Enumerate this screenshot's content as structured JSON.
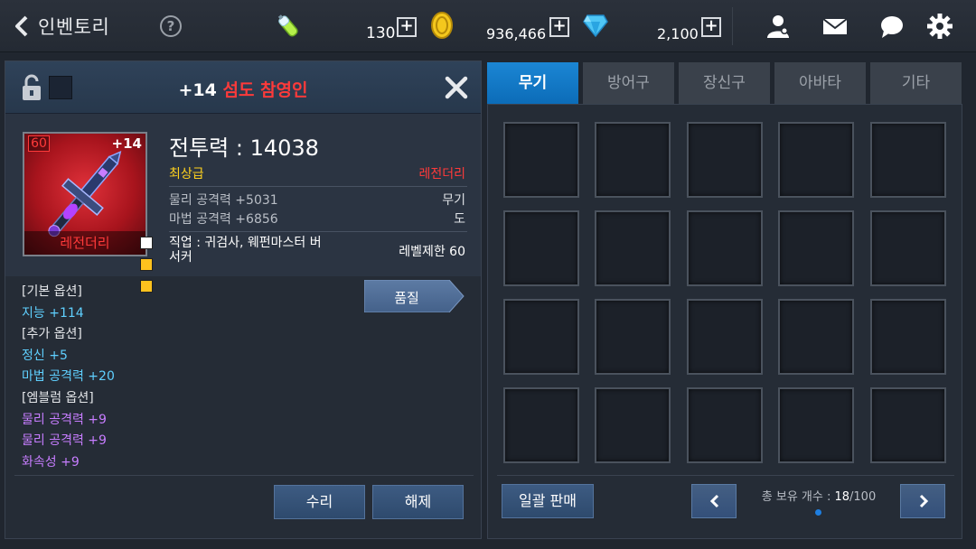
{
  "header": {
    "back_label": "인벤토리",
    "help": "?",
    "currencies": [
      {
        "icon": "potion-icon",
        "value": "130"
      },
      {
        "icon": "gold-coin-icon",
        "value": "936,466"
      },
      {
        "icon": "diamond-icon",
        "value": "2,100"
      }
    ],
    "plus": "+"
  },
  "item": {
    "enhance_prefix": "+14",
    "name": "섬도 참영인",
    "level": "60",
    "enhance": "+14",
    "rarity_label": "레전더리",
    "power_label": "전투력 : 14038",
    "grade": "최상급",
    "rarity": "레전더리",
    "phys_attack": "물리 공격력 +5031",
    "magic_attack": "마법 공격력 +6856",
    "type": "무기",
    "subtype": "도",
    "job": "직업 : 귀검사, 웨펀마스터 버서커",
    "level_req": "레벨제한 60",
    "quality_btn": "품질",
    "options": [
      {
        "text": "[기본 옵션]",
        "kind": "header"
      },
      {
        "text": "지능 +114",
        "kind": "basic"
      },
      {
        "text": "[추가 옵션]",
        "kind": "header"
      },
      {
        "text": "정신 +5",
        "kind": "basic"
      },
      {
        "text": "마법 공격력 +20",
        "kind": "basic"
      },
      {
        "text": "[엠블럼 옵션]",
        "kind": "header"
      },
      {
        "text": "물리 공격력 +9",
        "kind": "emblem"
      },
      {
        "text": "물리 공격력 +9",
        "kind": "emblem"
      },
      {
        "text": "화속성 +9",
        "kind": "emblem"
      }
    ],
    "repair_btn": "수리",
    "unequip_btn": "해제"
  },
  "tabs": [
    "무기",
    "방어구",
    "장신구",
    "아바타",
    "기타"
  ],
  "active_tab": 0,
  "inventory": {
    "bulk_sell": "일괄 판매",
    "count_label": "총 보유 개수 :",
    "count_current": "18",
    "count_max": "/100"
  },
  "colors": {
    "accent_blue": "#0c6cb8",
    "legendary_red": "#ff3a3a",
    "grade_yellow": "#ffd21e",
    "basic_option": "#5fd0ff",
    "emblem_option": "#c77dff"
  }
}
